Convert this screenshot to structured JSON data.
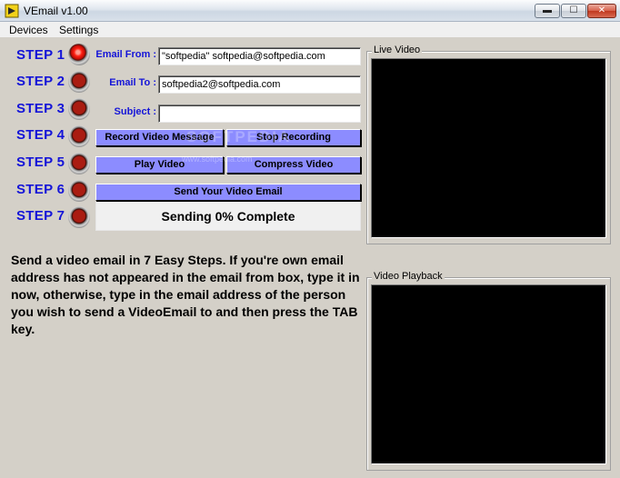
{
  "window": {
    "title": "VEmail v1.00",
    "min_glyph": "▬",
    "max_glyph": "☐",
    "close_glyph": "✕"
  },
  "menu": {
    "items": [
      "Devices",
      "Settings"
    ]
  },
  "steps": [
    "STEP 1",
    "STEP 2",
    "STEP 3",
    "STEP 4",
    "STEP 5",
    "STEP 6",
    "STEP 7"
  ],
  "form": {
    "email_from_label": "Email From :",
    "email_from_value": "\"softpedia\" softpedia@softpedia.com",
    "email_to_label": "Email To :",
    "email_to_value": "softpedia2@softpedia.com",
    "subject_label": "Subject :",
    "subject_value": ""
  },
  "buttons": {
    "record": "Record Video Message",
    "stop": "Stop Recording",
    "play": "Play Video",
    "compress": "Compress Video",
    "send": "Send Your Video Email"
  },
  "status": {
    "text": "Sending 0% Complete"
  },
  "instructions": "Send a video email in 7 Easy Steps. If you're own email address has not appeared in the email from box, type it in now, otherwise, type in the email address of the person you wish to send a VideoEmail to and then press the TAB key.",
  "live_video": {
    "title": "Live Video"
  },
  "video_playback": {
    "title": "Video Playback"
  },
  "watermark": {
    "text": "SOFTPEDIA",
    "url": "www.softpedia.com"
  },
  "colors": {
    "accent_text": "#1414d8",
    "button_fill": "#8c8cff",
    "led_active": "#ff1f12",
    "led_inactive": "#aa1c12",
    "video_background": "#000000"
  }
}
